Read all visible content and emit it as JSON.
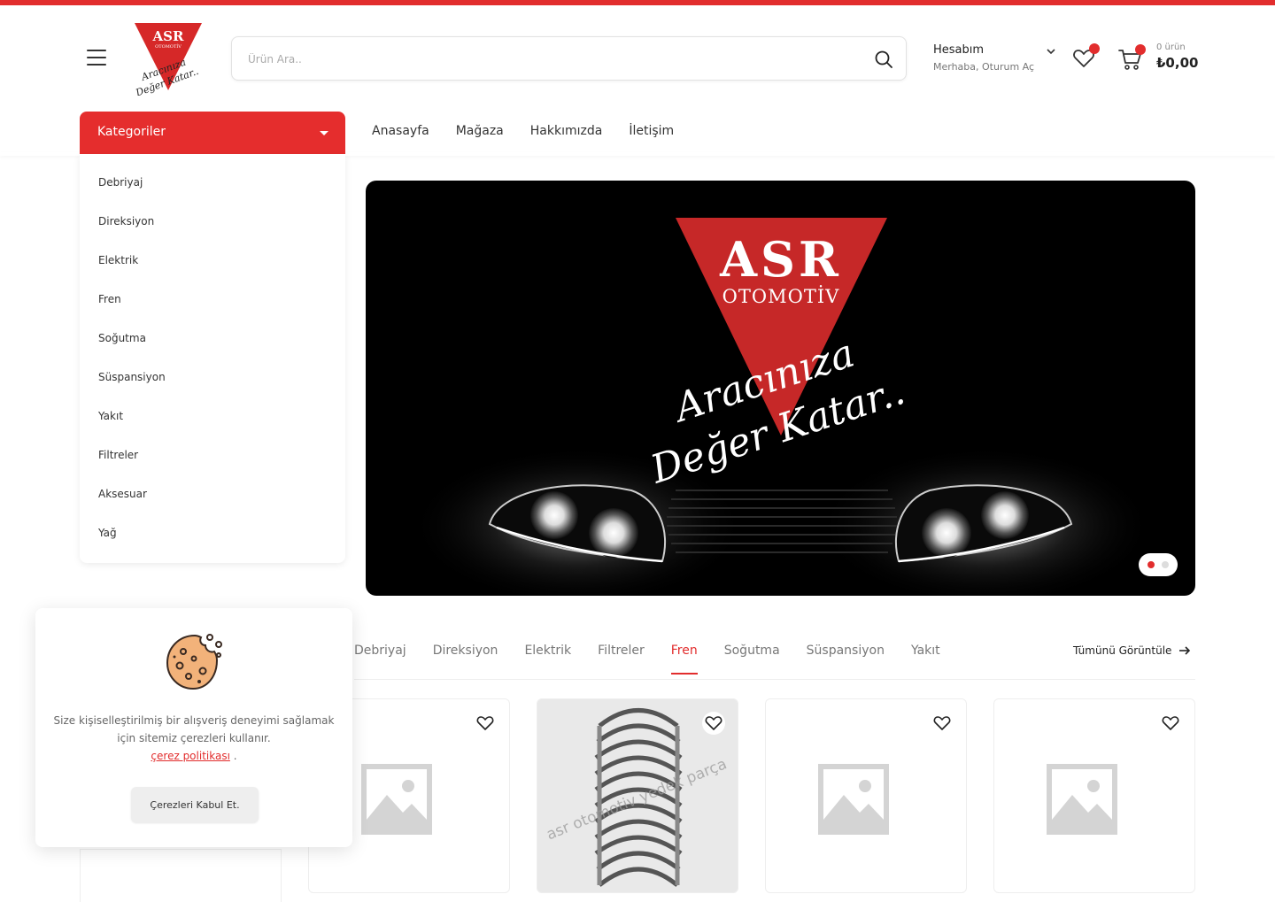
{
  "header": {
    "logo": {
      "brand": "ASR",
      "sub": "OTOMOTİV",
      "slogan_1": "Aracınıza",
      "slogan_2": "Değer Katar.."
    },
    "search_placeholder": "Ürün Ara..",
    "account_title": "Hesabım",
    "account_sub": "Merhaba, Oturum Aç",
    "cart_count": "0 ürün",
    "cart_total": "₺0,00",
    "colors": {
      "accent": "#e22d2d"
    }
  },
  "categories": {
    "title": "Kategoriler",
    "items": [
      "Debriyaj",
      "Direksiyon",
      "Elektrik",
      "Fren",
      "Soğutma",
      "Süspansiyon",
      "Yakıt",
      "Filtreler",
      "Aksesuar",
      "Yağ"
    ]
  },
  "nav": [
    "Anasayfa",
    "Mağaza",
    "Hakkımızda",
    "İletişim"
  ],
  "hero": {
    "brand": "ASR",
    "sub": "OTOMOTİV",
    "slogan_1": "Aracınıza",
    "slogan_2": "Değer Katar.."
  },
  "product_tabs": {
    "items": [
      "Debriyaj",
      "Direksiyon",
      "Elektrik",
      "Filtreler",
      "Fren",
      "Soğutma",
      "Süspansiyon",
      "Yakıt"
    ],
    "active": "Fren",
    "view_all": "Tümünü Görüntüle"
  },
  "products": [
    {
      "image": "placeholder-icon"
    },
    {
      "image": "bearing-photo",
      "watermark": "asr otomotiv yedek parça"
    },
    {
      "image": "placeholder-icon"
    },
    {
      "image": "placeholder-icon"
    }
  ],
  "cookie": {
    "text": "Size kişiselleştirilmiş bir alışveriş deneyimi sağlamak için sitemiz çerezleri kullanır.",
    "link": "çerez politikası",
    "button": "Çerezleri Kabul Et."
  }
}
